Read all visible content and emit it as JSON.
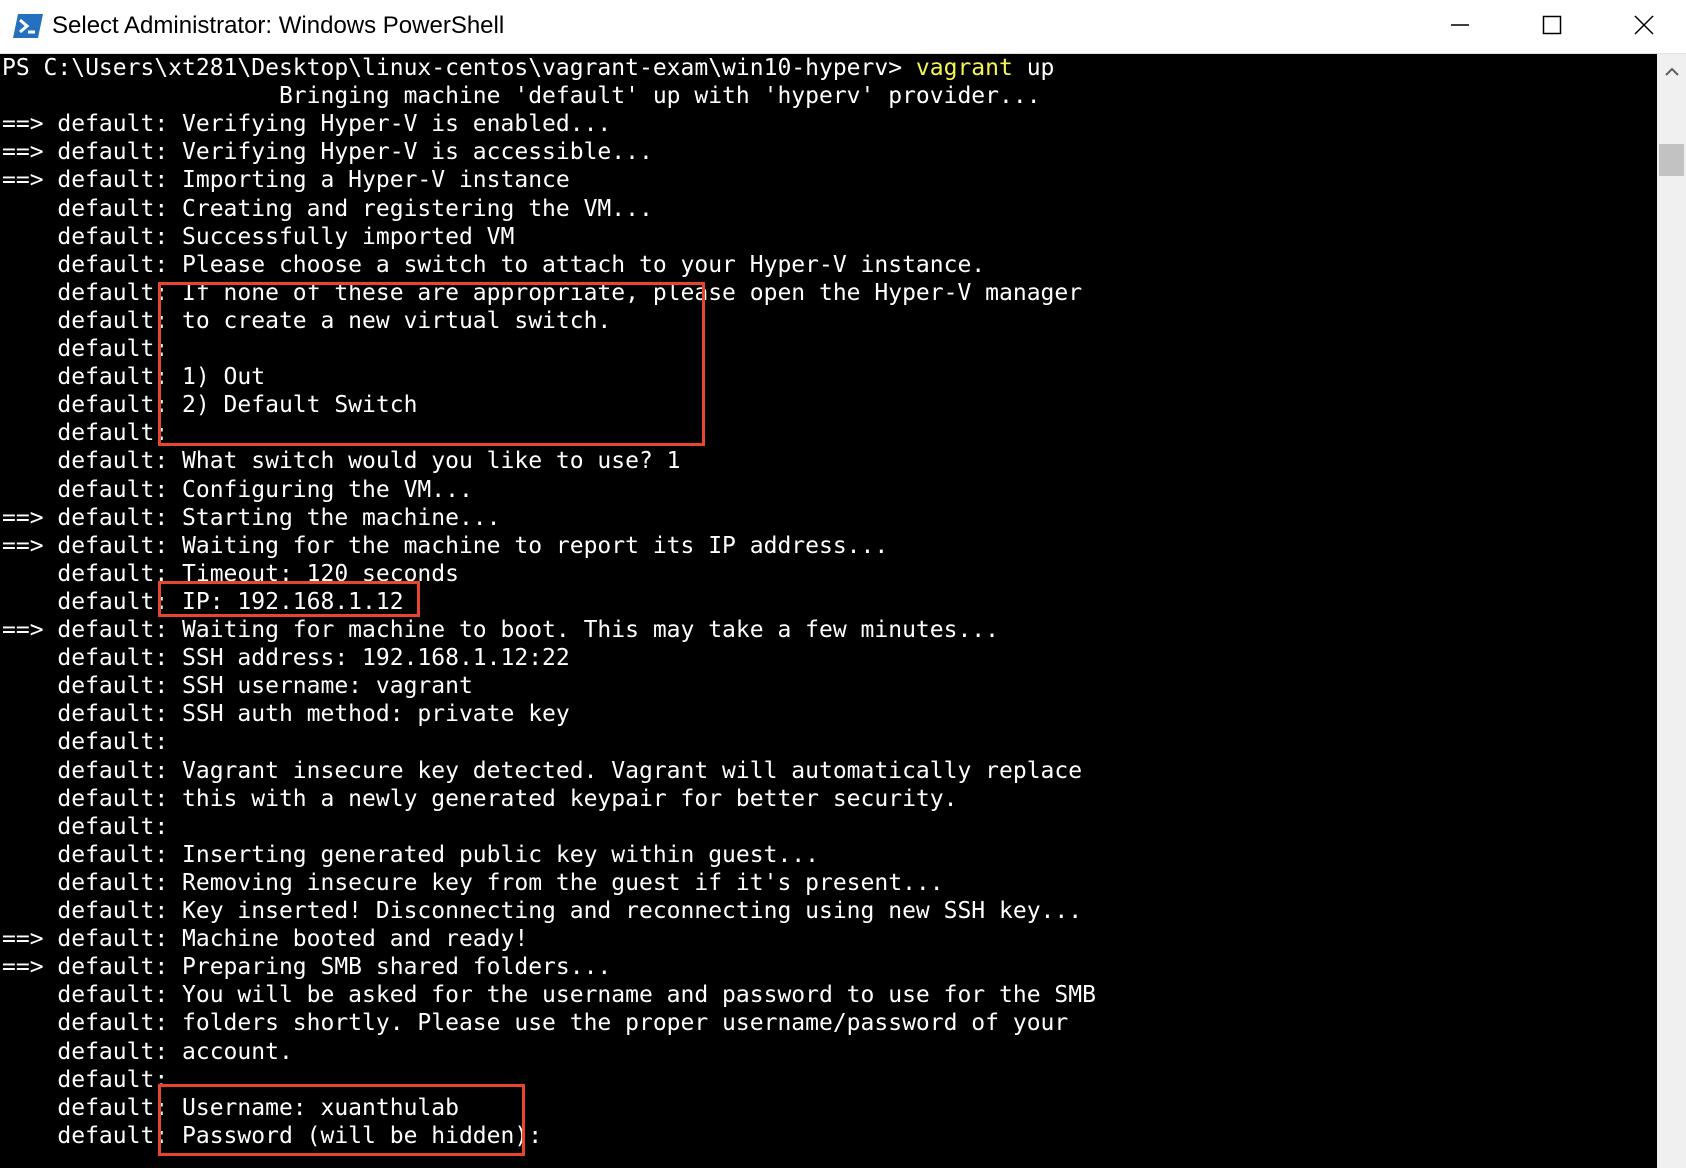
{
  "window": {
    "title": "Select Administrator: Windows PowerShell",
    "icon": "powershell-icon",
    "controls": [
      "minimize-icon",
      "maximize-icon",
      "close-icon"
    ]
  },
  "console": {
    "prompt": "PS C:\\Users\\xt281\\Desktop\\linux-centos\\vagrant-exam\\win10-hyperv> ",
    "command": "vagrant",
    "command_args": " up",
    "lines": [
      "                    Bringing machine 'default' up with 'hyperv' provider...",
      "==> default: Verifying Hyper-V is enabled...",
      "==> default: Verifying Hyper-V is accessible...",
      "==> default: Importing a Hyper-V instance",
      "    default: Creating and registering the VM...",
      "    default: Successfully imported VM",
      "    default: Please choose a switch to attach to your Hyper-V instance.",
      "    default: If none of these are appropriate, please open the Hyper-V manager",
      "    default: to create a new virtual switch.",
      "    default:",
      "    default: 1) Out",
      "    default: 2) Default Switch",
      "    default:",
      "    default: What switch would you like to use? 1",
      "    default: Configuring the VM...",
      "==> default: Starting the machine...",
      "==> default: Waiting for the machine to report its IP address...",
      "    default: Timeout: 120 seconds",
      "    default: IP: 192.168.1.12",
      "==> default: Waiting for machine to boot. This may take a few minutes...",
      "    default: SSH address: 192.168.1.12:22",
      "    default: SSH username: vagrant",
      "    default: SSH auth method: private key",
      "    default:",
      "    default: Vagrant insecure key detected. Vagrant will automatically replace",
      "    default: this with a newly generated keypair for better security.",
      "    default:",
      "    default: Inserting generated public key within guest...",
      "    default: Removing insecure key from the guest if it's present...",
      "    default: Key inserted! Disconnecting and reconnecting using new SSH key...",
      "==> default: Machine booted and ready!",
      "==> default: Preparing SMB shared folders...",
      "    default: You will be asked for the username and password to use for the SMB",
      "    default: folders shortly. Please use the proper username/password of your",
      "    default: account.",
      "    default:",
      "    default: Username: xuanthulab",
      "    default: Password (will be hidden):"
    ]
  },
  "highlight_color": "#e8452e",
  "command_color": "#f5f552"
}
